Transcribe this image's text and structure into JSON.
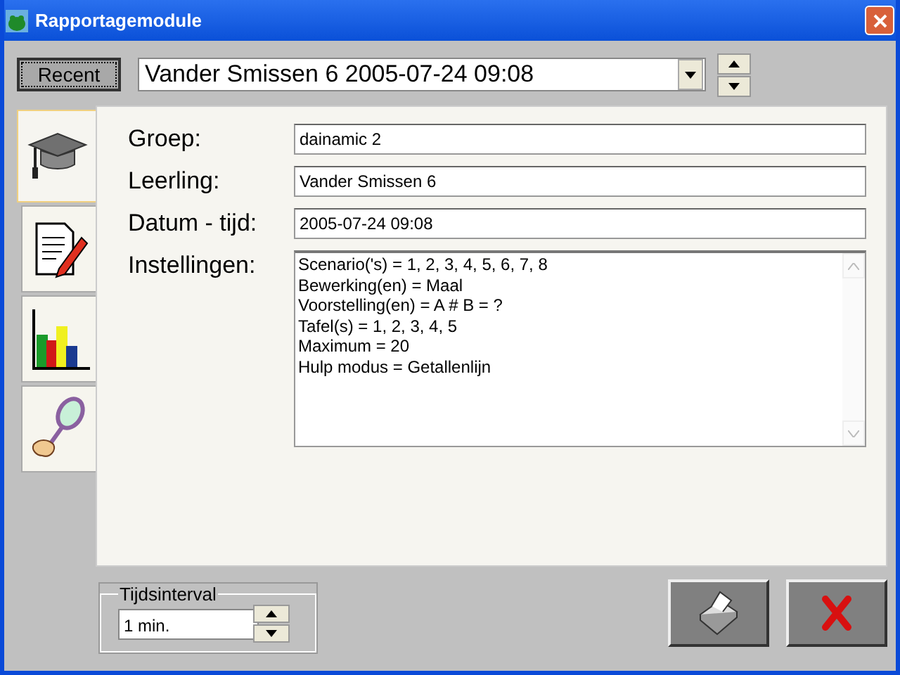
{
  "window": {
    "title": "Rapportagemodule"
  },
  "recent_button": "Recent",
  "session_select": {
    "value": "Vander Smissen 6 2005-07-24 09:08"
  },
  "tabs": [
    {
      "kind": "cap",
      "selected": true
    },
    {
      "kind": "edit",
      "selected": false
    },
    {
      "kind": "chart",
      "selected": false
    },
    {
      "kind": "magnifier",
      "selected": false
    }
  ],
  "fields": [
    {
      "label": "Groep:",
      "value": "dainamic 2"
    },
    {
      "label": "Leerling:",
      "value": "Vander Smissen 6"
    },
    {
      "label": "Datum - tijd:",
      "value": "2005-07-24 09:08"
    }
  ],
  "settings": {
    "label": "Instellingen:",
    "lines": [
      "Scenario('s) = 1, 2, 3, 4, 5, 6, 7, 8",
      "Bewerking(en) = Maal",
      "Voorstelling(en) = A # B = ?",
      "Tafel(s) = 1, 2, 3, 4, 5",
      "Maximum = 20",
      "Hulp modus = Getallenlijn"
    ]
  },
  "interval": {
    "legend": "Tijdsinterval",
    "value": "1 min."
  }
}
